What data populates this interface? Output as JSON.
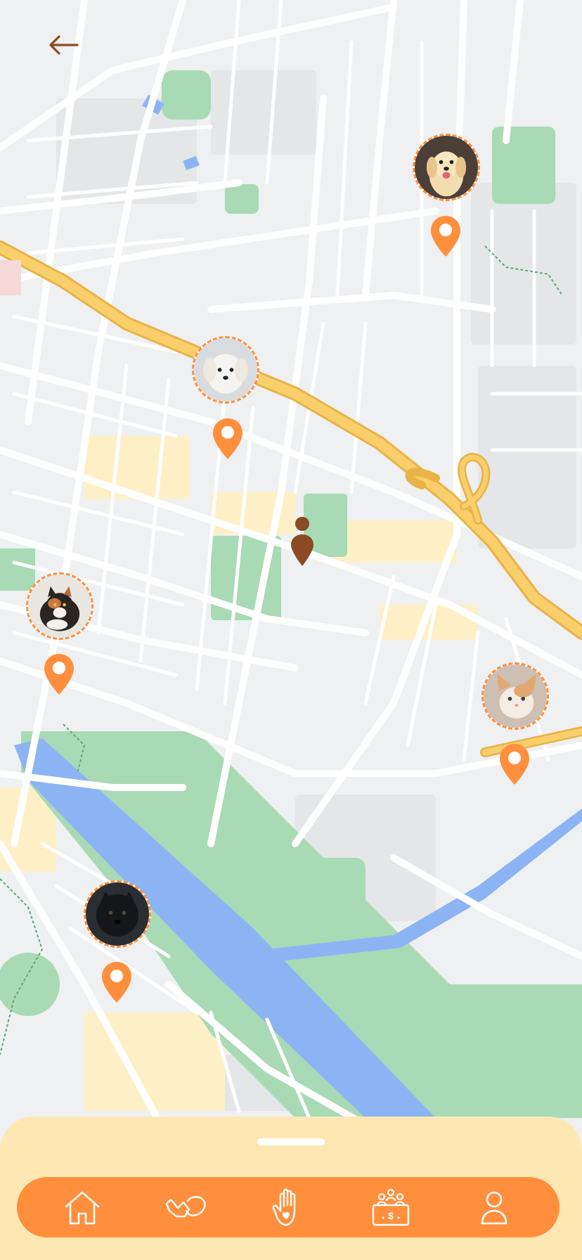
{
  "map": {
    "pets": [
      {
        "name": "pet-dog-cream"
      },
      {
        "name": "pet-dog-white"
      },
      {
        "name": "pet-cat-calico"
      },
      {
        "name": "pet-cat-orange"
      },
      {
        "name": "pet-dog-black"
      }
    ]
  },
  "icons": {
    "back": "arrow-left-icon",
    "user_location": "person-location-icon",
    "pin": "map-pin-icon"
  },
  "nav": {
    "items": [
      {
        "icon": "home-icon"
      },
      {
        "icon": "hand-paw-icon"
      },
      {
        "icon": "raised-hand-heart-icon"
      },
      {
        "icon": "donation-box-icon"
      },
      {
        "icon": "profile-icon"
      }
    ]
  },
  "colors": {
    "accent": "#ff8f3d",
    "sheet": "#ffe7b3",
    "map_bg": "#eef0f2",
    "road": "#ffffff",
    "highway": "#f7c55a",
    "water": "#8cb4f5",
    "park": "#a8dab5",
    "user_marker": "#8a4a23"
  }
}
